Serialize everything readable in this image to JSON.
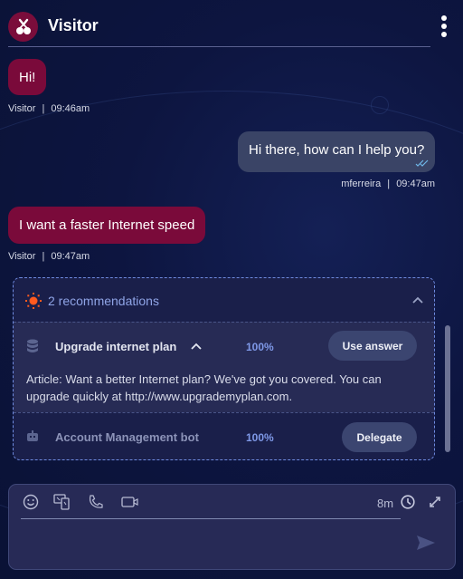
{
  "header": {
    "title": "Visitor",
    "avatar_icon": "cherry-icon",
    "menu_icon": "kebab-menu-icon"
  },
  "messages": [
    {
      "sender": "visitor",
      "text": "Hi!",
      "author": "Visitor",
      "separator": "|",
      "time": "09:46am"
    },
    {
      "sender": "agent",
      "text": "Hi there, how can I help you?",
      "author": "mferreira",
      "separator": "|",
      "time": "09:47am",
      "status_icon": "double-check-icon"
    },
    {
      "sender": "visitor",
      "text": "I want a faster Internet speed",
      "author": "Visitor",
      "separator": "|",
      "time": "09:47am"
    }
  ],
  "recommendations": {
    "header_label": "2 recommendations",
    "header_icon": "sun-icon",
    "collapse_icon": "chevron-up-icon",
    "items": [
      {
        "icon": "database-icon",
        "title": "Upgrade internet plan",
        "expand_icon": "chevron-up-icon",
        "confidence": "100%",
        "action_label": "Use answer",
        "article": "Article: Want a better Internet plan? We've got you covered. You can upgrade quickly at http://www.upgrademyplan.com."
      },
      {
        "icon": "robot-icon",
        "title": "Account Management bot",
        "confidence": "100%",
        "action_label": "Delegate"
      }
    ]
  },
  "composer": {
    "tools": [
      "emoji-icon",
      "screen-share-icon",
      "phone-icon",
      "video-icon"
    ],
    "timer": "8m",
    "timer_icon": "clock-icon",
    "expand_icon": "expand-icon",
    "input_value": "",
    "send_icon": "send-icon"
  },
  "colors": {
    "visitor_bubble": "#7a0a3a",
    "agent_bubble": "#3a4466",
    "accent": "#8fa4e6",
    "sun": "#ff5a1f"
  }
}
